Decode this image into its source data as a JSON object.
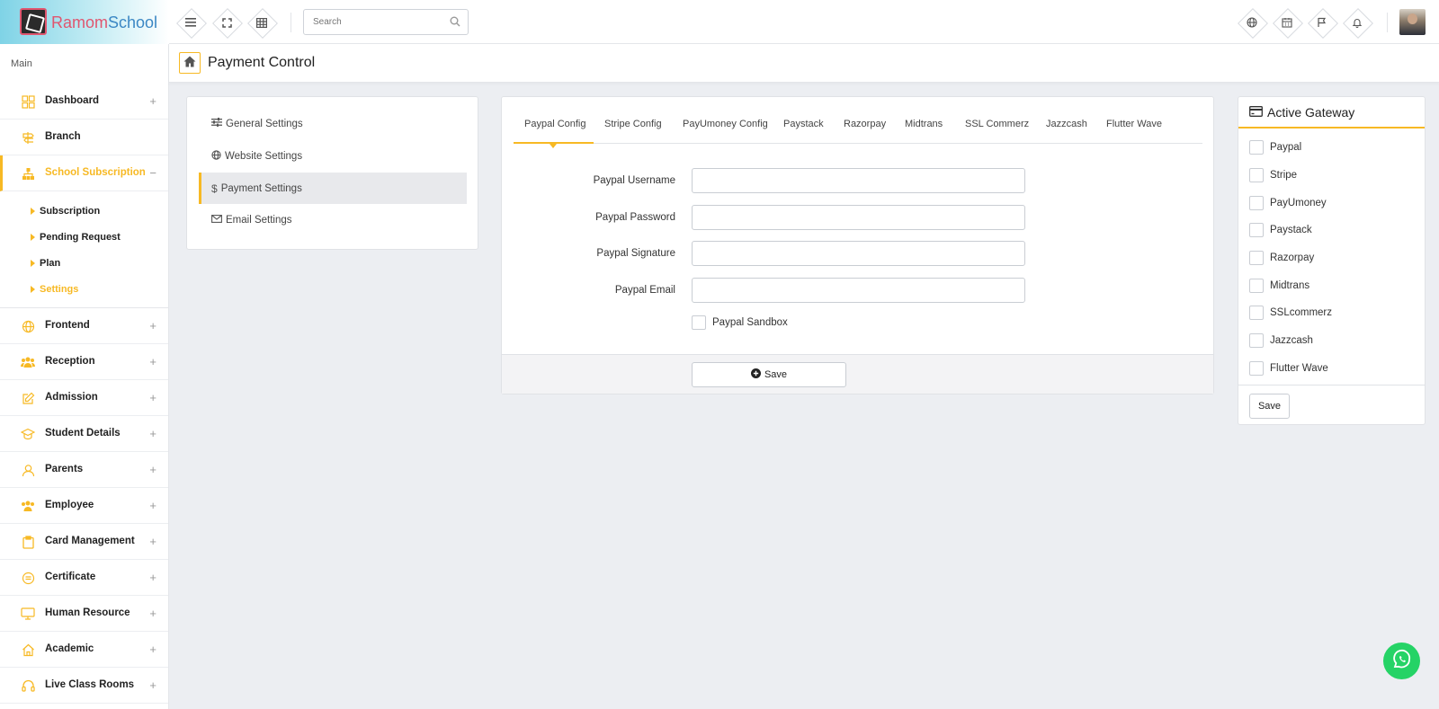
{
  "app": {
    "logo_part1": "Ramom",
    "logo_part2": "School",
    "accent_color": "#f7b924"
  },
  "topbar": {
    "search_placeholder": "Search",
    "left_icons": [
      "menu-icon",
      "fullscreen-icon",
      "grid-icon"
    ],
    "right_icons": [
      "globe-icon",
      "calendar-icon",
      "flag-icon",
      "bell-icon"
    ]
  },
  "sidebar": {
    "section_label": "Main",
    "items": [
      {
        "label": "Dashboard",
        "icon": "dashboard-icon"
      },
      {
        "label": "Branch",
        "icon": "signpost-icon"
      },
      {
        "label": "School Subscription",
        "icon": "sitemap-icon"
      },
      {
        "label": "Frontend",
        "icon": "globe-icon"
      },
      {
        "label": "Reception",
        "icon": "users-icon"
      },
      {
        "label": "Admission",
        "icon": "edit-icon"
      },
      {
        "label": "Student Details",
        "icon": "graduation-cap-icon"
      },
      {
        "label": "Parents",
        "icon": "user-icon"
      },
      {
        "label": "Employee",
        "icon": "group-icon"
      },
      {
        "label": "Card Management",
        "icon": "clipboard-icon"
      },
      {
        "label": "Certificate",
        "icon": "certificate-icon"
      },
      {
        "label": "Human Resource",
        "icon": "monitor-icon"
      },
      {
        "label": "Academic",
        "icon": "home-icon"
      },
      {
        "label": "Live Class Rooms",
        "icon": "headset-icon"
      }
    ],
    "subitems": [
      {
        "label": "Subscription"
      },
      {
        "label": "Pending Request"
      },
      {
        "label": "Plan"
      },
      {
        "label": "Settings"
      }
    ]
  },
  "page": {
    "title": "Payment Control"
  },
  "settings_menu": {
    "items": [
      {
        "label": "General Settings",
        "icon": "sliders-icon"
      },
      {
        "label": "Website Settings",
        "icon": "globe-icon"
      },
      {
        "label": "Payment Settings",
        "icon": "dollar-icon"
      },
      {
        "label": "Email Settings",
        "icon": "envelope-icon"
      }
    ]
  },
  "config": {
    "tabs": [
      {
        "label": "Paypal Config"
      },
      {
        "label": "Stripe Config"
      },
      {
        "label": "PayUmoney Config"
      },
      {
        "label": "Paystack"
      },
      {
        "label": "Razorpay"
      },
      {
        "label": "Midtrans"
      },
      {
        "label": "SSL Commerz"
      },
      {
        "label": "Jazzcash"
      },
      {
        "label": "Flutter Wave"
      }
    ],
    "fields": [
      {
        "label": "Paypal Username",
        "value": ""
      },
      {
        "label": "Paypal Password",
        "value": ""
      },
      {
        "label": "Paypal Signature",
        "value": ""
      },
      {
        "label": "Paypal Email",
        "value": ""
      }
    ],
    "sandbox_label": "Paypal Sandbox",
    "save_label": "Save"
  },
  "gateway": {
    "title": "Active Gateway",
    "options": [
      {
        "label": "Paypal",
        "checked": false
      },
      {
        "label": "Stripe",
        "checked": false
      },
      {
        "label": "PayUmoney",
        "checked": false
      },
      {
        "label": "Paystack",
        "checked": false
      },
      {
        "label": "Razorpay",
        "checked": false
      },
      {
        "label": "Midtrans",
        "checked": false
      },
      {
        "label": "SSLcommerz",
        "checked": false
      },
      {
        "label": "Jazzcash",
        "checked": false
      },
      {
        "label": "Flutter Wave",
        "checked": false
      }
    ],
    "save_label": "Save"
  }
}
